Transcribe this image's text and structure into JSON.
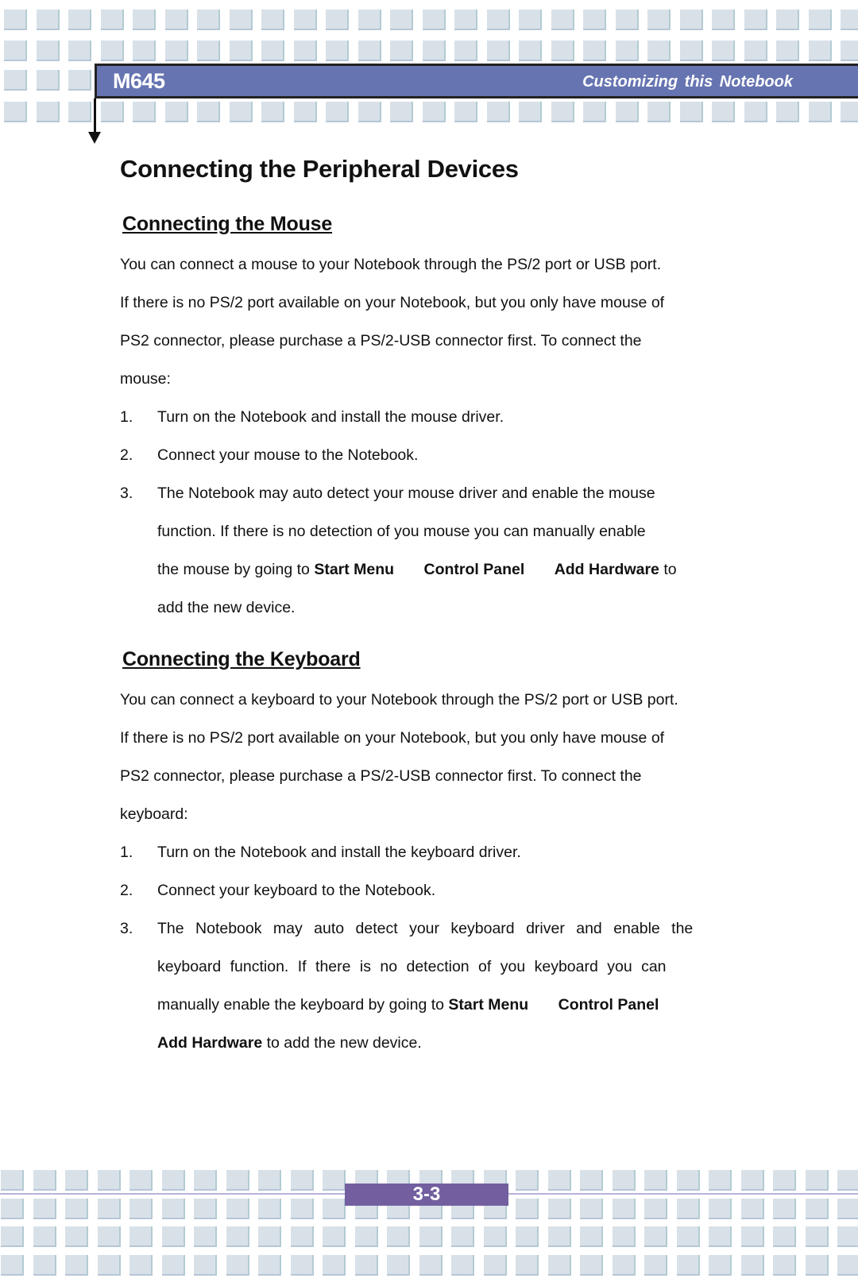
{
  "header": {
    "model": "M645",
    "section": "Customizing this Notebook"
  },
  "page": {
    "title": "Connecting the Peripheral Devices",
    "number": "3-3"
  },
  "mouse": {
    "heading": "Connecting the Mouse",
    "intro_lines": [
      "You can connect a mouse to your Notebook through the PS/2 port or USB port.",
      "If there is no PS/2 port available on your Notebook, but you only have mouse of",
      "PS2 connector, please purchase a PS/2-USB connector first.   To connect the",
      "mouse:"
    ],
    "steps": [
      {
        "num": "1.",
        "text": "Turn on the Notebook and install the mouse driver."
      },
      {
        "num": "2.",
        "text": "Connect your mouse to the Notebook."
      },
      {
        "num": "3.",
        "line1": "The Notebook may auto detect your mouse driver and enable the mouse",
        "line2": "function.   If there is no detection of you mouse you can manually enable",
        "line3_prefix": "the mouse by going to",
        "path": [
          "Start Menu",
          "Control Panel",
          "Add Hardware"
        ],
        "line3_suffix": "to",
        "line4": "add the new device."
      }
    ]
  },
  "keyboard": {
    "heading": "Connecting the Keyboard",
    "intro_lines": [
      "You can connect a keyboard to your Notebook through the PS/2 port or USB port.",
      "If there is no PS/2 port available on your Notebook, but you only have mouse of",
      "PS2 connector, please purchase a PS/2-USB connector first.   To connect the",
      "keyboard:"
    ],
    "steps": [
      {
        "num": "1.",
        "text": "Turn on the Notebook and install the keyboard driver."
      },
      {
        "num": "2.",
        "text": "Connect your keyboard to the Notebook."
      },
      {
        "num": "3.",
        "line1": "The Notebook may auto detect your keyboard driver and enable the",
        "line2": "keyboard function.  If there is no detection of you keyboard you can",
        "line3_prefix": "manually enable the keyboard by going to",
        "path": [
          "Start Menu",
          "Control Panel",
          "Add Hardware"
        ],
        "line4_suffix": "to add the new device."
      }
    ]
  },
  "colors": {
    "header_band": "#6674b1",
    "page_number_box": "#735f9f",
    "tile": "#d9e1e8"
  }
}
